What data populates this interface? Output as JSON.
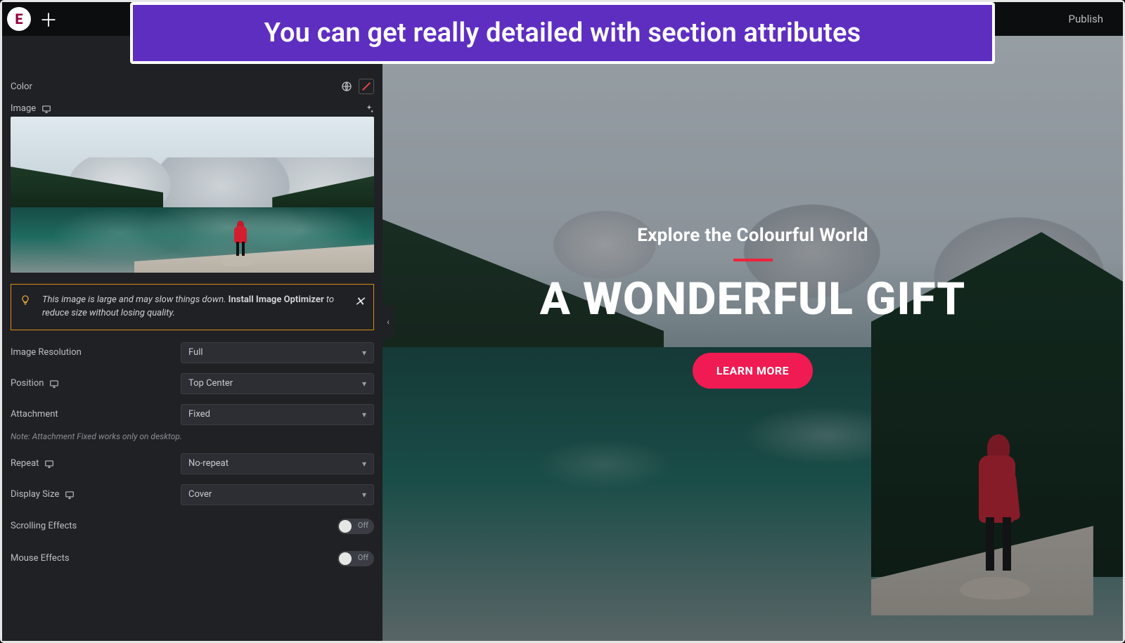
{
  "banner": "You can get really detailed with section attributes",
  "topbar": {
    "publish": "Publish"
  },
  "panel": {
    "labels": {
      "color": "Color",
      "image": "Image",
      "imageResolution": "Image Resolution",
      "position": "Position",
      "attachment": "Attachment",
      "repeat": "Repeat",
      "displaySize": "Display Size",
      "scrollingEffects": "Scrolling Effects",
      "mouseEffects": "Mouse Effects"
    },
    "values": {
      "imageResolution": "Full",
      "position": "Top Center",
      "attachment": "Fixed",
      "repeat": "No-repeat",
      "displaySize": "Cover"
    },
    "toggle": {
      "off": "Off"
    },
    "note": "Note: Attachment Fixed works only on desktop.",
    "tip": {
      "prefix": "This image is large and may slow things down. ",
      "strong": "Install Image Optimizer",
      "suffix": " to reduce size without losing quality."
    }
  },
  "hero": {
    "subtitle": "Explore the Colourful World",
    "headline": "A WONDERFUL GIFT",
    "cta": "LEARN MORE"
  },
  "colors": {
    "accent": "#ef1b52",
    "banner": "#5e2ec1",
    "warning": "#e08a14"
  }
}
